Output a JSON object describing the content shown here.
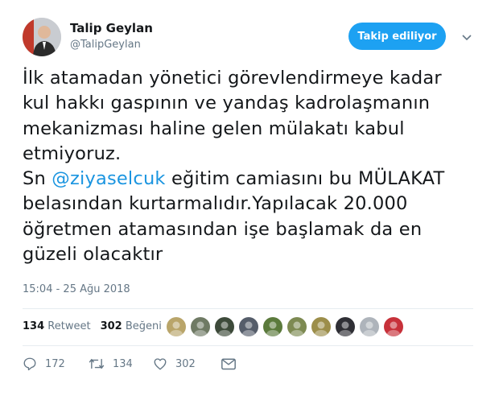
{
  "user": {
    "display_name": "Talip Geylan",
    "handle": "@TalipGeylan"
  },
  "follow_button_label": "Takip ediliyor",
  "tweet": {
    "lines": [
      "İlk atamadan yönetici görevlendirmeye kadar",
      "kul hakkı gaspının ve yandaş kadrolaşmanın",
      "mekanizması haline gelen mülakatı kabul",
      "etmiyoruz."
    ],
    "line5_prefix": "Sn ",
    "mention": "@ziyaselcuk",
    "line5_suffix": " eğitim camiasını bu MÜLAKAT",
    "lines_after": [
      "belasından kurtarmalıdır.Yapılacak 20.000",
      "öğretmen atamasından işe başlamak da en",
      "güzeli olacaktır"
    ]
  },
  "timestamp": "15:04 - 25 Ağu 2018",
  "stats": {
    "retweet_count": "134",
    "retweet_label": "Retweet",
    "like_count": "302",
    "like_label": "Beğeni"
  },
  "actions": {
    "reply_count": "172",
    "retweet_count": "134",
    "like_count": "302"
  },
  "colors": {
    "accent": "#1da1f2",
    "mention": "#1b95e0",
    "muted": "#657786"
  },
  "liker_avatars": [
    "#b9a56a",
    "#6f7a64",
    "#3d4a3a",
    "#555d6a",
    "#5b7a3c",
    "#7d8a52",
    "#9c8e4a",
    "#2f2f35",
    "#aeb4bb",
    "#c7313a"
  ]
}
